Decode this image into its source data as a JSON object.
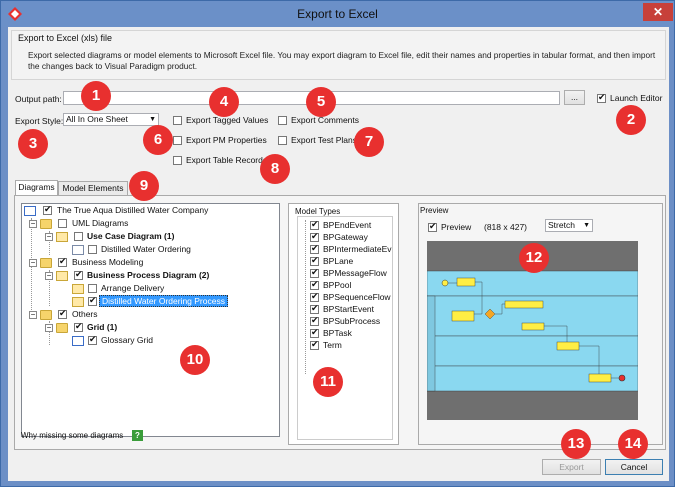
{
  "window": {
    "title": "Export to Excel",
    "close_glyph": "✕",
    "minimize_glyph": "",
    "maximize_glyph": ""
  },
  "header": {
    "title": "Export to Excel (xls) file",
    "description": "Export selected diagrams or model elements to Microsoft Excel file. You may export diagram to Excel file, edit their names and properties in tabular format, and then import the changes back to Visual Paradigm product."
  },
  "output": {
    "label": "Output path:",
    "value": "",
    "browse_label": "...",
    "launch_editor_label": "Launch Editor",
    "launch_editor_checked": true
  },
  "style": {
    "label": "Export Style:",
    "selected": "All In One Sheet"
  },
  "options": {
    "tagged_values": "Export Tagged Values",
    "comments": "Export Comments",
    "pm_properties": "Export PM Properties",
    "test_plans": "Export Test Plans",
    "table_records": "Export Table Records"
  },
  "tabs": [
    "Diagrams",
    "Model Elements"
  ],
  "tree": {
    "project": "The True Aqua Distilled Water Company",
    "uml_folder": "UML Diagrams",
    "use_case_group": "Use Case Diagram (1)",
    "use_case_item": "Distilled Water Ordering",
    "bm_folder": "Business Modeling",
    "bp_group": "Business Process Diagram (2)",
    "bp_item1": "Arrange Delivery",
    "bp_item2": "Distilled Water Ordering Process",
    "others_folder": "Others",
    "grid_group": "Grid (1)",
    "grid_item": "Glossary Grid"
  },
  "why_missing": "Why missing some diagrams",
  "help_glyph": "?",
  "model_types": {
    "label": "Model Types",
    "items": [
      "BPEndEvent",
      "BPGateway",
      "BPIntermediateEv",
      "BPLane",
      "BPMessageFlow",
      "BPPool",
      "BPSequenceFlow",
      "BPStartEvent",
      "BPSubProcess",
      "BPTask",
      "Term"
    ]
  },
  "preview": {
    "label": "Preview",
    "checkbox_label": "Preview",
    "size": "(818 x 427)",
    "mode": "Stretch"
  },
  "buttons": {
    "export": "Export",
    "cancel": "Cancel"
  },
  "badges": [
    "1",
    "2",
    "3",
    "4",
    "5",
    "6",
    "7",
    "8",
    "9",
    "10",
    "11",
    "12",
    "13",
    "14"
  ],
  "colors": {
    "badge": "#e8302f",
    "titlebar": "#6b90c8",
    "selection": "#3399ff",
    "lane": "#7fd3ee"
  }
}
